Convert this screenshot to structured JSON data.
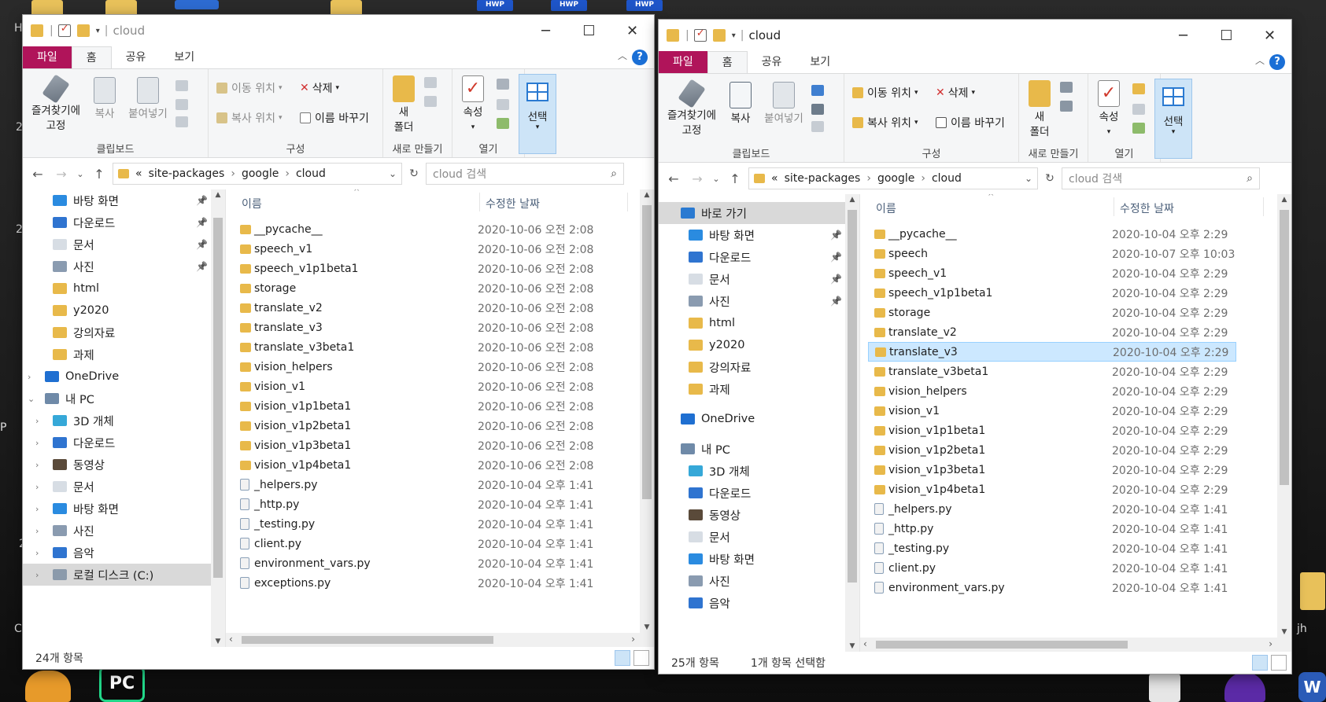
{
  "desktop": {
    "hwp_label": "HWP",
    "left_letters": [
      "H",
      "2",
      "2",
      "P",
      "2",
      "C"
    ],
    "right_letter": "jh"
  },
  "colors": {
    "file_tab": "#b0145a",
    "selection": "#cce8ff",
    "folder": "#e8b94a",
    "accent_blue": "#1a6fd6"
  },
  "windows": [
    {
      "title": "cloud",
      "tabs": [
        "파일",
        "홈",
        "공유",
        "보기"
      ],
      "ribbon": {
        "pin_label": [
          "즐겨찾기에",
          "고정"
        ],
        "copy": "복사",
        "paste": "붙여넣기",
        "group_clipboard": "클립보드",
        "move_to": "이동 위치",
        "copy_to": "복사 위치",
        "delete": "삭제",
        "rename": "이름 바꾸기",
        "group_organize": "구성",
        "new_folder": [
          "새",
          "폴더"
        ],
        "group_new": "새로 만들기",
        "properties": "속성",
        "group_open": "열기",
        "select": "선택"
      },
      "address": {
        "overflow": "«",
        "crumbs": [
          "site-packages",
          "google",
          "cloud"
        ]
      },
      "search_placeholder": "cloud 검색",
      "nav": [
        {
          "label": "바탕 화면",
          "icon": "desktop-icon",
          "pinned": true,
          "indent": 2
        },
        {
          "label": "다운로드",
          "icon": "download-icon",
          "pinned": true,
          "indent": 2
        },
        {
          "label": "문서",
          "icon": "document-icon",
          "pinned": true,
          "indent": 2
        },
        {
          "label": "사진",
          "icon": "pictures-icon",
          "pinned": true,
          "indent": 2
        },
        {
          "label": "html",
          "icon": "folder-icon",
          "pinned": false,
          "indent": 2
        },
        {
          "label": "y2020",
          "icon": "folder-icon",
          "pinned": false,
          "indent": 2
        },
        {
          "label": "강의자료",
          "icon": "folder-icon",
          "pinned": false,
          "indent": 2
        },
        {
          "label": "과제",
          "icon": "folder-icon",
          "pinned": false,
          "indent": 2
        },
        {
          "label": "OneDrive",
          "icon": "onedrive-icon",
          "pinned": false,
          "indent": 1,
          "chevron": "›"
        },
        {
          "label": "내 PC",
          "icon": "pc-icon",
          "pinned": false,
          "indent": 1,
          "chevron": "⌄"
        },
        {
          "label": "3D 개체",
          "icon": "3d-objects-icon",
          "pinned": false,
          "indent": 2,
          "chevron": "›"
        },
        {
          "label": "다운로드",
          "icon": "download-icon",
          "pinned": false,
          "indent": 2,
          "chevron": "›"
        },
        {
          "label": "동영상",
          "icon": "video-icon",
          "pinned": false,
          "indent": 2,
          "chevron": "›"
        },
        {
          "label": "문서",
          "icon": "document-icon",
          "pinned": false,
          "indent": 2,
          "chevron": "›"
        },
        {
          "label": "바탕 화면",
          "icon": "desktop-icon",
          "pinned": false,
          "indent": 2,
          "chevron": "›"
        },
        {
          "label": "사진",
          "icon": "pictures-icon",
          "pinned": false,
          "indent": 2,
          "chevron": "›"
        },
        {
          "label": "음악",
          "icon": "music-icon",
          "pinned": false,
          "indent": 2,
          "chevron": "›"
        },
        {
          "label": "로컬 디스크 (C:)",
          "icon": "drive-icon",
          "pinned": false,
          "indent": 2,
          "chevron": "›",
          "active": true
        }
      ],
      "columns": {
        "name": "이름",
        "date": "수정한 날짜"
      },
      "files": [
        {
          "name": "__pycache__",
          "date": "2020-10-06 오전 2:08",
          "type": "folder"
        },
        {
          "name": "speech_v1",
          "date": "2020-10-06 오전 2:08",
          "type": "folder"
        },
        {
          "name": "speech_v1p1beta1",
          "date": "2020-10-06 오전 2:08",
          "type": "folder"
        },
        {
          "name": "storage",
          "date": "2020-10-06 오전 2:08",
          "type": "folder"
        },
        {
          "name": "translate_v2",
          "date": "2020-10-06 오전 2:08",
          "type": "folder"
        },
        {
          "name": "translate_v3",
          "date": "2020-10-06 오전 2:08",
          "type": "folder"
        },
        {
          "name": "translate_v3beta1",
          "date": "2020-10-06 오전 2:08",
          "type": "folder"
        },
        {
          "name": "vision_helpers",
          "date": "2020-10-06 오전 2:08",
          "type": "folder"
        },
        {
          "name": "vision_v1",
          "date": "2020-10-06 오전 2:08",
          "type": "folder"
        },
        {
          "name": "vision_v1p1beta1",
          "date": "2020-10-06 오전 2:08",
          "type": "folder"
        },
        {
          "name": "vision_v1p2beta1",
          "date": "2020-10-06 오전 2:08",
          "type": "folder"
        },
        {
          "name": "vision_v1p3beta1",
          "date": "2020-10-06 오전 2:08",
          "type": "folder"
        },
        {
          "name": "vision_v1p4beta1",
          "date": "2020-10-06 오전 2:08",
          "type": "folder"
        },
        {
          "name": "_helpers.py",
          "date": "2020-10-04 오후 1:41",
          "type": "py"
        },
        {
          "name": "_http.py",
          "date": "2020-10-04 오후 1:41",
          "type": "py"
        },
        {
          "name": "_testing.py",
          "date": "2020-10-04 오후 1:41",
          "type": "py"
        },
        {
          "name": "client.py",
          "date": "2020-10-04 오후 1:41",
          "type": "py"
        },
        {
          "name": "environment_vars.py",
          "date": "2020-10-04 오후 1:41",
          "type": "py"
        },
        {
          "name": "exceptions.py",
          "date": "2020-10-04 오후 1:41",
          "type": "py"
        }
      ],
      "status": {
        "count": "24개 항목",
        "selected": ""
      }
    },
    {
      "title": "cloud",
      "tabs": [
        "파일",
        "홈",
        "공유",
        "보기"
      ],
      "ribbon": {
        "pin_label": [
          "즐겨찾기에",
          "고정"
        ],
        "copy": "복사",
        "paste": "붙여넣기",
        "group_clipboard": "클립보드",
        "move_to": "이동 위치",
        "copy_to": "복사 위치",
        "delete": "삭제",
        "rename": "이름 바꾸기",
        "group_organize": "구성",
        "new_folder": [
          "새",
          "폴더"
        ],
        "group_new": "새로 만들기",
        "properties": "속성",
        "group_open": "열기",
        "select": "선택"
      },
      "address": {
        "overflow": "«",
        "crumbs": [
          "site-packages",
          "google",
          "cloud"
        ]
      },
      "search_placeholder": "cloud 검색",
      "nav": [
        {
          "label": "바로 가기",
          "icon": "star-icon",
          "pinned": false,
          "indent": 1,
          "chevron": "",
          "active": true
        },
        {
          "label": "바탕 화면",
          "icon": "desktop-icon",
          "pinned": true,
          "indent": 2
        },
        {
          "label": "다운로드",
          "icon": "download-icon",
          "pinned": true,
          "indent": 2
        },
        {
          "label": "문서",
          "icon": "document-icon",
          "pinned": true,
          "indent": 2
        },
        {
          "label": "사진",
          "icon": "pictures-icon",
          "pinned": true,
          "indent": 2
        },
        {
          "label": "html",
          "icon": "folder-icon",
          "pinned": false,
          "indent": 2
        },
        {
          "label": "y2020",
          "icon": "folder-icon",
          "pinned": false,
          "indent": 2
        },
        {
          "label": "강의자료",
          "icon": "folder-icon",
          "pinned": false,
          "indent": 2
        },
        {
          "label": "과제",
          "icon": "folder-icon",
          "pinned": false,
          "indent": 2
        },
        {
          "label": "OneDrive",
          "icon": "onedrive-icon",
          "pinned": false,
          "indent": 1,
          "gap": true
        },
        {
          "label": "내 PC",
          "icon": "pc-icon",
          "pinned": false,
          "indent": 1,
          "gap": true
        },
        {
          "label": "3D 개체",
          "icon": "3d-objects-icon",
          "pinned": false,
          "indent": 2
        },
        {
          "label": "다운로드",
          "icon": "download-icon",
          "pinned": false,
          "indent": 2
        },
        {
          "label": "동영상",
          "icon": "video-icon",
          "pinned": false,
          "indent": 2
        },
        {
          "label": "문서",
          "icon": "document-icon",
          "pinned": false,
          "indent": 2
        },
        {
          "label": "바탕 화면",
          "icon": "desktop-icon",
          "pinned": false,
          "indent": 2
        },
        {
          "label": "사진",
          "icon": "pictures-icon",
          "pinned": false,
          "indent": 2
        },
        {
          "label": "음악",
          "icon": "music-icon",
          "pinned": false,
          "indent": 2
        }
      ],
      "columns": {
        "name": "이름",
        "date": "수정한 날짜"
      },
      "files": [
        {
          "name": "__pycache__",
          "date": "2020-10-04 오후 2:29",
          "type": "folder"
        },
        {
          "name": "speech",
          "date": "2020-10-07 오후 10:03",
          "type": "folder"
        },
        {
          "name": "speech_v1",
          "date": "2020-10-04 오후 2:29",
          "type": "folder"
        },
        {
          "name": "speech_v1p1beta1",
          "date": "2020-10-04 오후 2:29",
          "type": "folder"
        },
        {
          "name": "storage",
          "date": "2020-10-04 오후 2:29",
          "type": "folder"
        },
        {
          "name": "translate_v2",
          "date": "2020-10-04 오후 2:29",
          "type": "folder"
        },
        {
          "name": "translate_v3",
          "date": "2020-10-04 오후 2:29",
          "type": "folder",
          "selected": true
        },
        {
          "name": "translate_v3beta1",
          "date": "2020-10-04 오후 2:29",
          "type": "folder"
        },
        {
          "name": "vision_helpers",
          "date": "2020-10-04 오후 2:29",
          "type": "folder"
        },
        {
          "name": "vision_v1",
          "date": "2020-10-04 오후 2:29",
          "type": "folder"
        },
        {
          "name": "vision_v1p1beta1",
          "date": "2020-10-04 오후 2:29",
          "type": "folder"
        },
        {
          "name": "vision_v1p2beta1",
          "date": "2020-10-04 오후 2:29",
          "type": "folder"
        },
        {
          "name": "vision_v1p3beta1",
          "date": "2020-10-04 오후 2:29",
          "type": "folder"
        },
        {
          "name": "vision_v1p4beta1",
          "date": "2020-10-04 오후 2:29",
          "type": "folder"
        },
        {
          "name": "_helpers.py",
          "date": "2020-10-04 오후 1:41",
          "type": "py"
        },
        {
          "name": "_http.py",
          "date": "2020-10-04 오후 1:41",
          "type": "py"
        },
        {
          "name": "_testing.py",
          "date": "2020-10-04 오후 1:41",
          "type": "py"
        },
        {
          "name": "client.py",
          "date": "2020-10-04 오후 1:41",
          "type": "py"
        },
        {
          "name": "environment_vars.py",
          "date": "2020-10-04 오후 1:41",
          "type": "py"
        }
      ],
      "status": {
        "count": "25개 항목",
        "selected": "1개 항목 선택함"
      }
    }
  ],
  "taskbar": {
    "pycharm_label": "PC",
    "word_label": "W"
  }
}
